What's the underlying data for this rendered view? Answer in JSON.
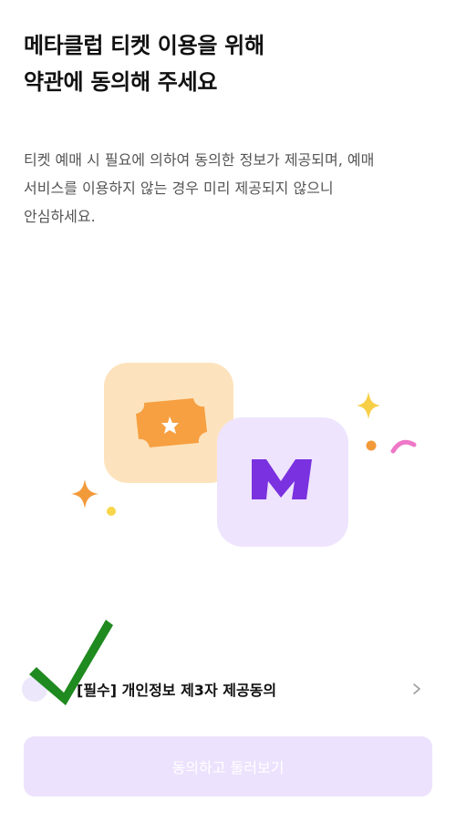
{
  "header": {
    "title_line1": "메타클럽 티켓 이용을 위해",
    "title_line2": "약관에 동의해 주세요"
  },
  "description": {
    "line1": "티켓 예매 시 필요에 의하여 동의한 정보가 제공되며, 예매",
    "line2": "서비스를 이용하지 않는 경우 미리 제공되지 않으니",
    "line3": "안심하세요."
  },
  "illustration": {
    "ticket_card_color": "#fde3bd",
    "ticket_color": "#f6a042",
    "logo_card_color": "#efe4fd",
    "logo_letter": "M",
    "logo_color": "#7a31e0"
  },
  "consent": {
    "label": "[필수] 개인정보 제3자 제공동의",
    "checked": true,
    "check_color": "#1f8a1f"
  },
  "cta": {
    "label": "동의하고 둘러보기",
    "enabled": false,
    "bg_color": "#ece2fd"
  }
}
